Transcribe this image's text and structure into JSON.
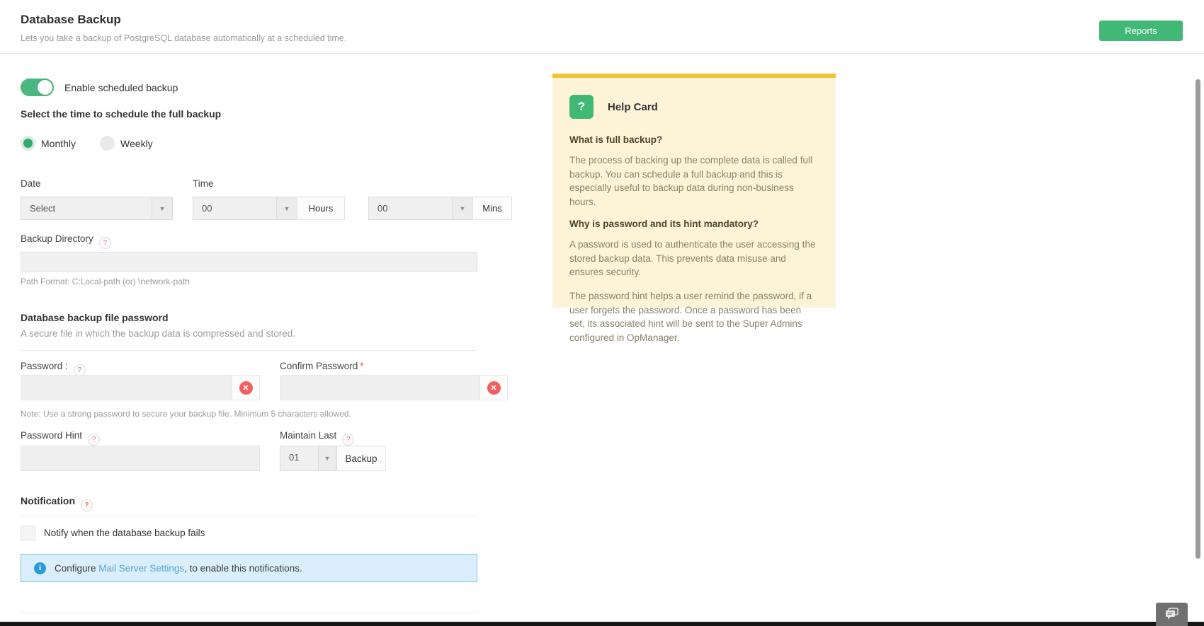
{
  "header": {
    "title": "Database Backup",
    "subtitle": "Lets you take a backup of PostgreSQL database automatically at a scheduled time.",
    "reports_button": "Reports"
  },
  "schedule": {
    "toggle_label": "Enable scheduled backup",
    "section_title": "Select the time to schedule the full backup",
    "frequency_options": [
      {
        "label": "Monthly",
        "selected": true
      },
      {
        "label": "Weekly",
        "selected": false
      }
    ],
    "date": {
      "label": "Date",
      "value": "Select"
    },
    "time": {
      "label": "Time",
      "hours_value": "00",
      "hours_unit": "Hours",
      "mins_value": "00",
      "mins_unit": "Mins"
    },
    "backup_directory": {
      "label": "Backup Directory",
      "value": "",
      "hint": "Path Format: C:Local-path (or) \\network-path"
    }
  },
  "password_section": {
    "title": "Database backup file password",
    "subtitle": "A secure file in which the backup data is compressed and stored.",
    "password_label": "Password :",
    "confirm_label": "Confirm Password",
    "required_mark": "*",
    "error_glyph": "✕",
    "note": "Note: Use a strong password to secure your backup file. Minimum 5 characters allowed.",
    "hint_label": "Password Hint",
    "maintain_label": "Maintain Last",
    "maintain_value": "01",
    "maintain_unit": "Backup"
  },
  "notification": {
    "title": "Notification",
    "checkbox_label": "Notify when the database backup fails",
    "checkbox_checked": false,
    "info_prefix": "Configure ",
    "info_link": "Mail Server Settings",
    "info_suffix": ", to enable this notifications.",
    "info_icon_glyph": "i"
  },
  "help_card": {
    "icon_glyph": "?",
    "title": "Help Card",
    "sections": [
      {
        "question": "What is full backup?",
        "answers": [
          "The process of backing up the complete data is called full backup. You can schedule a full backup and this is especially useful to backup data during non-business hours."
        ]
      },
      {
        "question": "Why is password and its hint mandatory?",
        "answers": [
          "A password is used to authenticate the user accessing the stored backup data. This prevents data misuse and ensures security.",
          "The password hint helps a user remind the password, if a user forgets the password. Once a password has been set, its associated hint will be sent to the Super Admins configured in OpManager."
        ]
      }
    ]
  },
  "misc": {
    "help_glyph": "?",
    "caret_glyph": "▼"
  },
  "colors": {
    "accent_green": "#42b876",
    "help_card_yellow": "#f2c230",
    "help_card_bg": "#fdf3d8",
    "error_red": "#f15f5f",
    "info_blue": "#2e9bd6",
    "link_blue": "#55a5d9"
  }
}
